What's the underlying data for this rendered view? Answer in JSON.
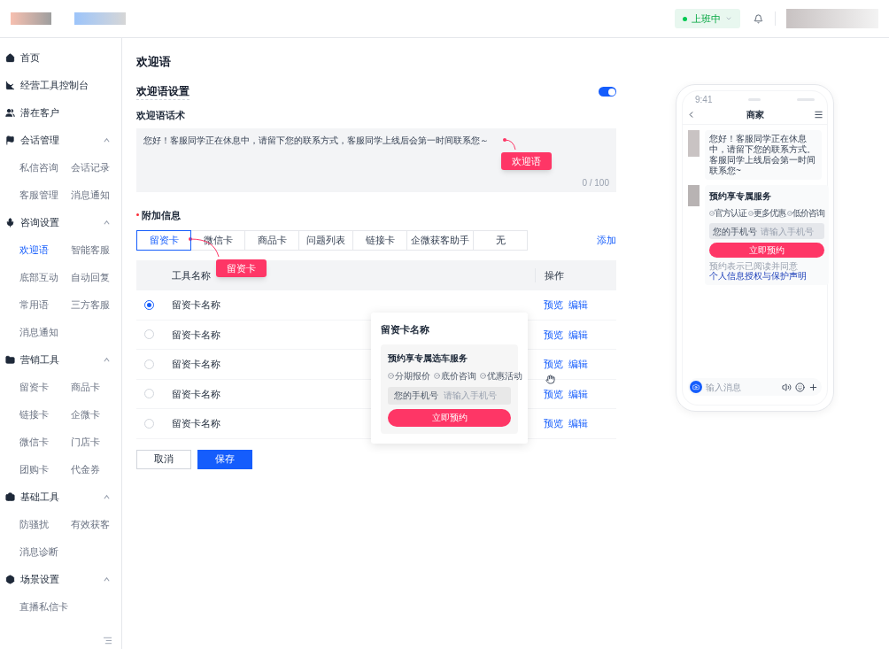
{
  "header": {
    "status": {
      "label": "上班中",
      "online": true
    }
  },
  "sidebar": {
    "groups": [
      {
        "label": "首页"
      },
      {
        "label": "经营工具控制台"
      },
      {
        "label": "潜在客户"
      },
      {
        "label": "会话管理",
        "expanded": true,
        "children": [
          {
            "label": "私信咨询",
            "selected": false
          },
          {
            "label": "会话记录",
            "selected": false
          },
          {
            "label": "客服管理",
            "selected": false
          },
          {
            "label": "消息通知",
            "selected": false
          }
        ]
      },
      {
        "label": "咨询设置",
        "expanded": true,
        "children": [
          {
            "label": "欢迎语",
            "selected": true
          },
          {
            "label": "智能客服",
            "selected": false
          },
          {
            "label": "底部互动",
            "selected": false
          },
          {
            "label": "自动回复",
            "selected": false
          },
          {
            "label": "常用语",
            "selected": false
          },
          {
            "label": "三方客服",
            "selected": false
          },
          {
            "label": "消息通知",
            "selected": false
          }
        ]
      },
      {
        "label": "营销工具",
        "expanded": true,
        "children": [
          {
            "label": "留资卡",
            "selected": false
          },
          {
            "label": "商品卡",
            "selected": false
          },
          {
            "label": "链接卡",
            "selected": false
          },
          {
            "label": "企微卡",
            "selected": false
          },
          {
            "label": "微信卡",
            "selected": false
          },
          {
            "label": "门店卡",
            "selected": false
          },
          {
            "label": "团购卡",
            "selected": false
          },
          {
            "label": "代金券",
            "selected": false
          }
        ]
      },
      {
        "label": "基础工具",
        "expanded": true,
        "children": [
          {
            "label": "防骚扰",
            "selected": false
          },
          {
            "label": "有效获客",
            "selected": false
          },
          {
            "label": "消息诊断",
            "selected": false
          }
        ]
      },
      {
        "label": "场景设置",
        "expanded": true,
        "children": [
          {
            "label": "直播私信卡",
            "selected": false
          }
        ]
      }
    ]
  },
  "page": {
    "title": "欢迎语",
    "setting": {
      "label": "欢迎语设置",
      "on": true
    },
    "script": {
      "label": "欢迎语话术",
      "value": "您好！客服同学正在休息中，请留下您的联系方式，客服同学上线后会第一时间联系您～",
      "counter": "0 / 100"
    },
    "extra": {
      "label": "附加信息",
      "required": true,
      "add": "添加",
      "tabs": [
        {
          "label": "留资卡",
          "selected": true
        },
        {
          "label": "微信卡",
          "selected": false
        },
        {
          "label": "商品卡",
          "selected": false
        },
        {
          "label": "问题列表",
          "selected": false
        },
        {
          "label": "链接卡",
          "selected": false
        },
        {
          "label": "企微获客助手",
          "selected": false
        },
        {
          "label": "无",
          "selected": false
        }
      ]
    },
    "table": {
      "columns": [
        "工具名称",
        "操作"
      ],
      "rows": [
        {
          "name": "留资卡名称",
          "selected": true,
          "actions": [
            "预览",
            "编辑"
          ]
        },
        {
          "name": "留资卡名称",
          "selected": false,
          "actions": [
            "预览",
            "编辑"
          ]
        },
        {
          "name": "留资卡名称",
          "selected": false,
          "actions": [
            "预览",
            "编辑"
          ]
        },
        {
          "name": "留资卡名称",
          "selected": false,
          "actions": [
            "预览",
            "编辑"
          ]
        },
        {
          "name": "留资卡名称",
          "selected": false,
          "actions": [
            "预览",
            "编辑"
          ]
        }
      ]
    },
    "buttons": [
      {
        "label": "取消",
        "kind": "secondary"
      },
      {
        "label": "保存",
        "kind": "primary"
      }
    ],
    "annotations": [
      "欢迎语",
      "留资卡"
    ],
    "popup": {
      "title": "留资卡名称",
      "card_title": "预约享专属选车服务",
      "tags": [
        "分期报价",
        "底价咨询",
        "优惠活动"
      ],
      "field_label": "您的手机号",
      "placeholder": "请输入手机号",
      "button": "立即预约"
    }
  },
  "phone": {
    "time": "9:41",
    "title": "商家",
    "message": "您好！客服同学正在休息中，请留下您的联系方式。客服同学上线后会第一时间联系您~",
    "card": {
      "title": "预约享专属服务",
      "tags": [
        "官方认证",
        "更多优惠",
        "低价咨询"
      ],
      "field_label": "您的手机号",
      "placeholder": "请输入手机号",
      "button": "立即预约",
      "note": "预约表示已阅读并同意",
      "link": "个人信息授权与保护声明"
    },
    "input_placeholder": "输入消息"
  }
}
